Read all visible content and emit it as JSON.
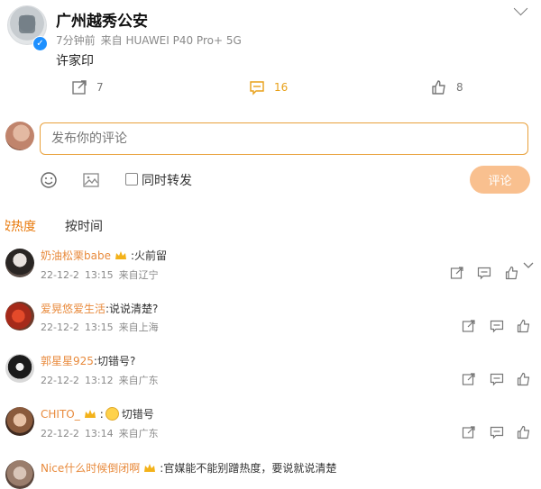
{
  "post": {
    "author": "广州越秀公安",
    "time": "7分钟前",
    "source": "来自 HUAWEI P40 Pro+ 5G",
    "body": "许家印",
    "reposts": "7",
    "comments": "16",
    "likes": "8"
  },
  "composer": {
    "placeholder": "发布你的评论",
    "repost_label": "同时转发",
    "submit_label": "评论"
  },
  "sort": {
    "hot_label": "按热度",
    "time_label": "按时间"
  },
  "comments": [
    {
      "author": "奶油松栗babe",
      "text": ":火前留",
      "date": "22-12-2",
      "time": "13:15",
      "location": "来自辽宁"
    },
    {
      "author": "爱晃悠爱生活",
      "text": ":说说清楚?",
      "date": "22-12-2",
      "time": "13:15",
      "location": "来自上海"
    },
    {
      "author": "郭星星925",
      "text": ":切错号?",
      "date": "22-12-2",
      "time": "13:12",
      "location": "来自广东"
    },
    {
      "author": "CHITO_",
      "text": "切错号",
      "date": "22-12-2",
      "time": "13:14",
      "location": "来自广东"
    },
    {
      "author": "Nice什么时候倒闭啊",
      "text": ":官媒能不能别蹭热度，要说就说清楚"
    }
  ],
  "colors": {
    "accent": "#e8a018",
    "name_orange": "#e88a3c",
    "submit_bg": "#f9c08f"
  },
  "icons": [
    "chevron-down-icon",
    "repost-icon",
    "comment-icon",
    "like-icon",
    "emoji-icon",
    "image-icon",
    "crown-icon"
  ]
}
